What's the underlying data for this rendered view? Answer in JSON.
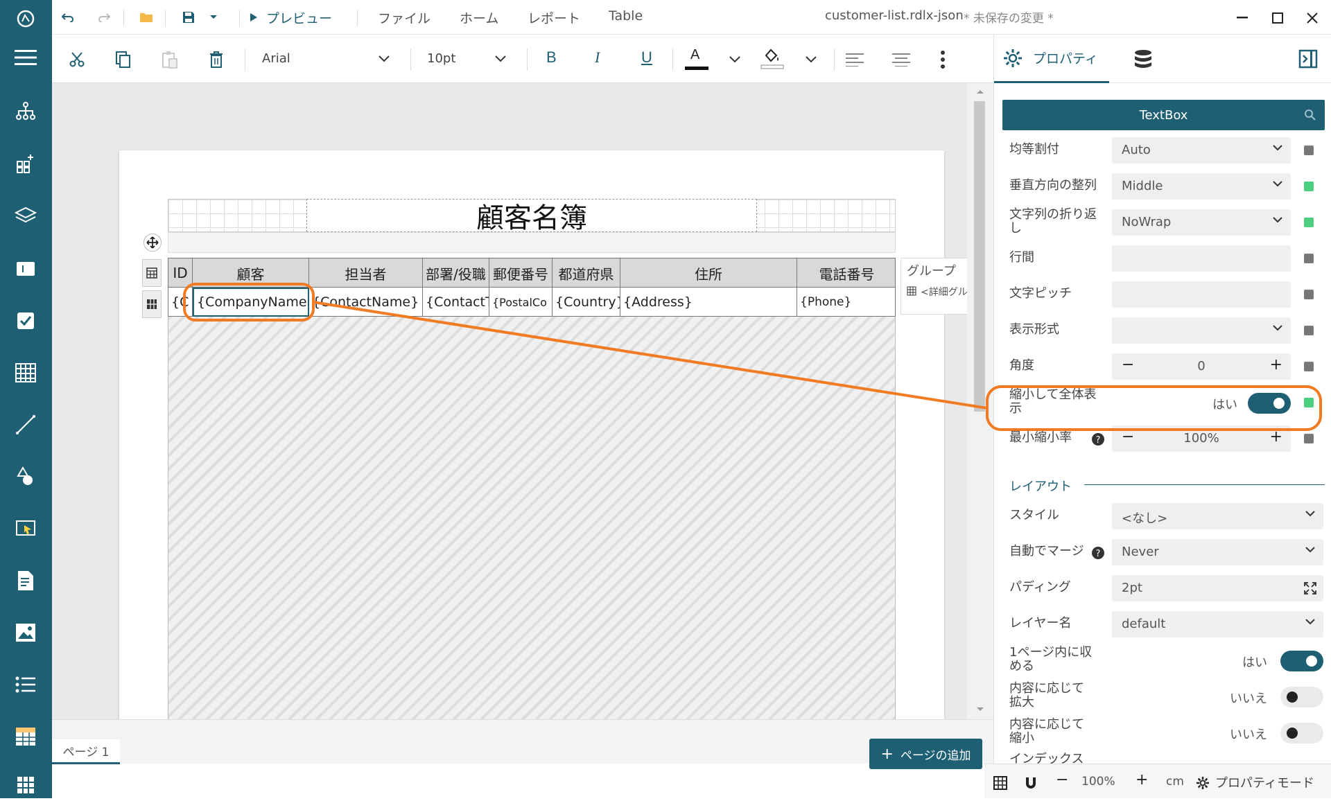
{
  "app": {
    "file_name": "customer-list.rdlx-json",
    "unsaved": "* 未保存の変更 *"
  },
  "menu": {
    "preview": "プレビュー",
    "file": "ファイル",
    "home": "ホーム",
    "report": "レポート",
    "table": "Table"
  },
  "toolbar": {
    "font_family": "Arial",
    "font_size": "10pt",
    "bold": "B",
    "italic": "I",
    "underline": "U",
    "font_color_glyph": "A"
  },
  "panel": {
    "tab_properties": "プロパティ",
    "component": "TextBox",
    "rows": [
      {
        "label": "均等割付",
        "value": "Auto"
      },
      {
        "label": "垂直方向の整列",
        "value": "Middle"
      },
      {
        "label": "文字列の折り返し",
        "value": "NoWrap"
      },
      {
        "label": "行間",
        "value": ""
      },
      {
        "label": "文字ピッチ",
        "value": ""
      },
      {
        "label": "表示形式",
        "value": ""
      },
      {
        "label": "角度",
        "value": "0"
      },
      {
        "label": "縮小して全体表示",
        "value": "はい"
      },
      {
        "label": "最小縮小率",
        "value": "100%"
      }
    ],
    "section_layout": "レイアウト",
    "layout_rows": [
      {
        "label": "スタイル",
        "value": "<なし>"
      },
      {
        "label": "自動でマージ",
        "value": "Never"
      },
      {
        "label": "パディング",
        "value": "2pt"
      },
      {
        "label": "レイヤー名",
        "value": "default"
      },
      {
        "label": "1ページ内に収める",
        "value": "はい"
      },
      {
        "label": "内容に応じて拡大",
        "value": "いいえ"
      },
      {
        "label": "内容に応じて縮小",
        "value": "いいえ"
      },
      {
        "label": "インデックス",
        "value": ""
      }
    ]
  },
  "report": {
    "title": "顧客名簿",
    "headers": [
      "ID",
      "顧客",
      "担当者",
      "部署/役職",
      "郵便番号",
      "都道府県",
      "住所",
      "電話番号"
    ],
    "details": [
      "{C",
      "{CompanyName}",
      "{ContactName}",
      "{ContactT",
      "{PostalCo",
      "{Country}",
      "{Address}",
      "{Phone}"
    ],
    "group_panel_title": "グループ",
    "group_detail": "<詳細グル"
  },
  "bottom": {
    "page_tab": "ページ 1",
    "add_page": "ページの追加"
  },
  "status": {
    "zoom": "100%",
    "unit": "cm",
    "property_mode": "プロパティモード"
  },
  "colors": {
    "brand": "#1e5f74",
    "accent_orange": "#f07b22",
    "status_green": "#4cd080"
  }
}
